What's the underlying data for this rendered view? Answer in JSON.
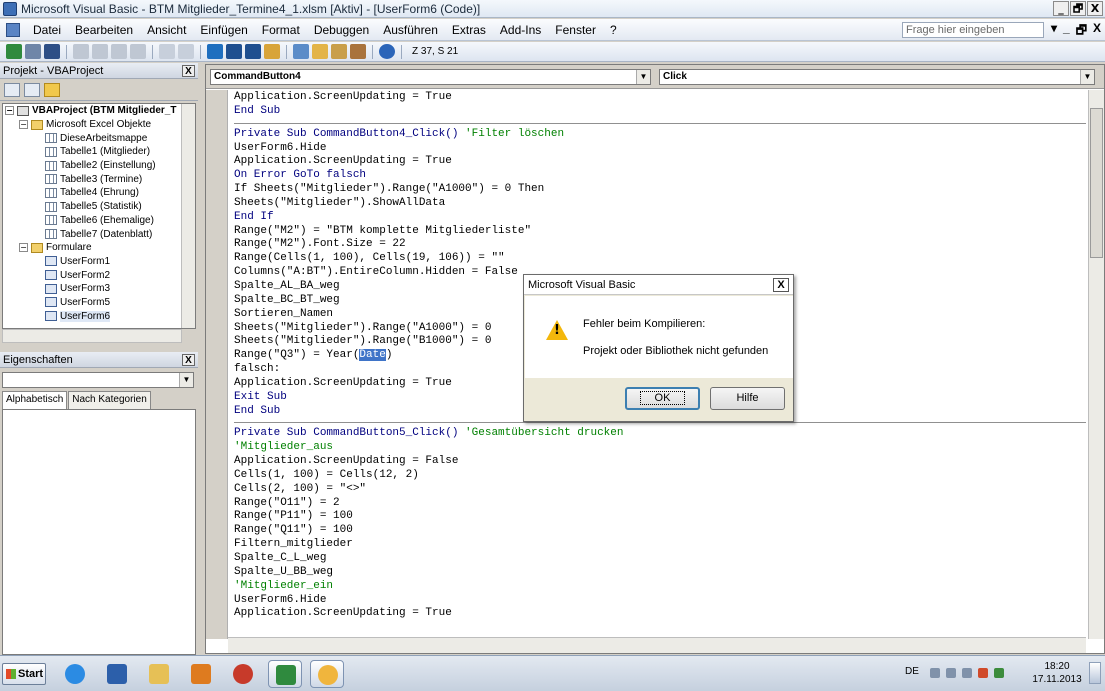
{
  "window": {
    "title": "Microsoft Visual Basic - BTM Mitglieder_Termine4_1.xlsm [Aktiv] - [UserForm6 (Code)]",
    "minimize": "_",
    "maximize": "🗗",
    "close": "X"
  },
  "menu": {
    "items": [
      "Datei",
      "Bearbeiten",
      "Ansicht",
      "Einfügen",
      "Format",
      "Debuggen",
      "Ausführen",
      "Extras",
      "Add-Ins",
      "Fenster",
      "?"
    ],
    "ask_placeholder": "Frage hier eingeben",
    "mdi_buttons": [
      "▾",
      "_",
      "🗗",
      "X"
    ]
  },
  "toolbar": {
    "position_text": "Z 37, S 21"
  },
  "project_panel": {
    "title": "Projekt - VBAProject",
    "close": "X",
    "tree": {
      "project": "VBAProject (BTM Mitglieder_T",
      "excel_folder": "Microsoft Excel Objekte",
      "excel_items": [
        "DieseArbeitsmappe",
        "Tabelle1 (Mitglieder)",
        "Tabelle2 (Einstellung)",
        "Tabelle3 (Termine)",
        "Tabelle4 (Ehrung)",
        "Tabelle5 (Statistik)",
        "Tabelle6 (Ehemalige)",
        "Tabelle7 (Datenblatt)"
      ],
      "forms_folder": "Formulare",
      "form_items": [
        "UserForm1",
        "UserForm2",
        "UserForm3",
        "UserForm5",
        "UserForm6"
      ]
    }
  },
  "props_panel": {
    "title": "Eigenschaften",
    "close": "X",
    "tabs": [
      "Alphabetisch",
      "Nach Kategorien"
    ]
  },
  "code_window": {
    "object_combo": "CommandButton4",
    "proc_combo": "Click",
    "lines": [
      {
        "t": "Application.ScreenUpdating = True",
        "k": "plain"
      },
      {
        "t": "End Sub",
        "k": "kw"
      },
      {
        "t": "",
        "k": "sep"
      },
      {
        "t": "Private Sub CommandButton4_Click() ",
        "c": "'Filter löschen",
        "k": "proc"
      },
      {
        "t": "UserForm6.Hide",
        "k": "plain"
      },
      {
        "t": "Application.ScreenUpdating = True",
        "k": "plain"
      },
      {
        "t": "On Error GoTo falsch",
        "k": "kw"
      },
      {
        "t": "If Sheets(\"Mitglieder\").Range(\"A1000\") = 0 Then",
        "k": "plain"
      },
      {
        "t": "Sheets(\"Mitglieder\").ShowAllData",
        "k": "plain"
      },
      {
        "t": "End If",
        "k": "kw"
      },
      {
        "t": "Range(\"M2\") = \"BTM komplette Mitgliederliste\"",
        "k": "plain"
      },
      {
        "t": "Range(\"M2\").Font.Size = 22",
        "k": "plain"
      },
      {
        "t": "Range(Cells(1, 100), Cells(19, 106)) = \"\"",
        "k": "plain"
      },
      {
        "t": "Columns(\"A:BT\").EntireColumn.Hidden = False",
        "k": "plain"
      },
      {
        "t": "Spalte_AL_BA_weg",
        "k": "plain"
      },
      {
        "t": "Spalte_BC_BT_weg",
        "k": "plain"
      },
      {
        "t": "Sortieren_Namen",
        "k": "plain"
      },
      {
        "t": "Sheets(\"Mitglieder\").Range(\"A1000\") = 0",
        "k": "plain"
      },
      {
        "t": "Sheets(\"Mitglieder\").Range(\"B1000\") = 0",
        "k": "plain"
      },
      {
        "t": "Range(\"Q3\") = Year(",
        "h": "Date",
        "a": ")",
        "k": "hl"
      },
      {
        "t": "falsch:",
        "k": "plain"
      },
      {
        "t": "Application.ScreenUpdating = True",
        "k": "plain"
      },
      {
        "t": "Exit Sub",
        "k": "kw"
      },
      {
        "t": "End Sub",
        "k": "kw"
      },
      {
        "t": "",
        "k": "sep"
      },
      {
        "t": "Private Sub CommandButton5_Click() ",
        "c": "'Gesamtübersicht drucken",
        "k": "proc"
      },
      {
        "t": "'Mitglieder_aus",
        "k": "cm"
      },
      {
        "t": "Application.ScreenUpdating = False",
        "k": "plain"
      },
      {
        "t": "Cells(1, 100) = Cells(12, 2)",
        "k": "plain"
      },
      {
        "t": "Cells(2, 100) = \"<>\"",
        "k": "plain"
      },
      {
        "t": "Range(\"O11\") = 2",
        "k": "plain"
      },
      {
        "t": "Range(\"P11\") = 100",
        "k": "plain"
      },
      {
        "t": "Range(\"Q11\") = 100",
        "k": "plain"
      },
      {
        "t": "Filtern_mitglieder",
        "k": "plain"
      },
      {
        "t": "Spalte_C_L_weg",
        "k": "plain"
      },
      {
        "t": "Spalte_U_BB_weg",
        "k": "plain"
      },
      {
        "t": "'Mitglieder_ein",
        "k": "cm"
      },
      {
        "t": "UserForm6.Hide",
        "k": "plain"
      },
      {
        "t": "Application.ScreenUpdating = True",
        "k": "plain"
      }
    ]
  },
  "dialog": {
    "title": "Microsoft Visual Basic",
    "close": "X",
    "message_line1": "Fehler beim Kompilieren:",
    "message_line2": "Projekt oder Bibliothek nicht gefunden",
    "ok_label": "OK",
    "help_label": "Hilfe"
  },
  "taskbar": {
    "start_label": "Start",
    "language": "DE",
    "time": "18:20",
    "date": "17.11.2013"
  }
}
